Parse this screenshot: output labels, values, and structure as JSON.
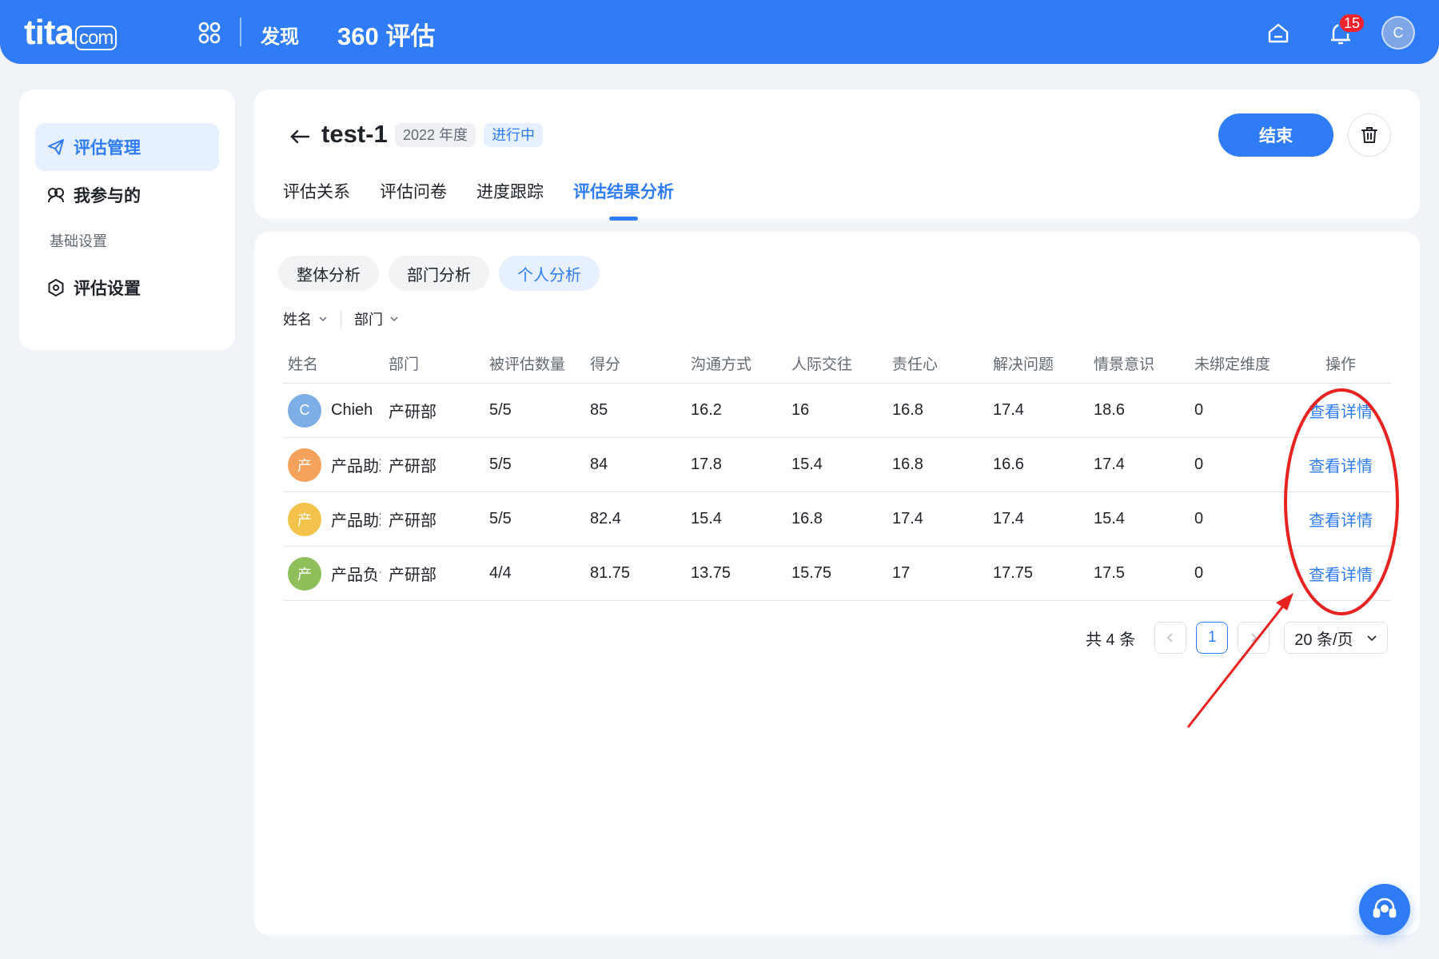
{
  "topbar": {
    "logo": "tita",
    "logo_suffix": "com",
    "nav_discover": "发现",
    "nav_title": "360 评估",
    "notification_count": "15",
    "user_initial": "C"
  },
  "sidebar": {
    "items": [
      {
        "label": "评估管理",
        "icon": "send-icon",
        "active": true
      },
      {
        "label": "我参与的",
        "icon": "people-icon",
        "active": false
      }
    ],
    "section_label": "基础设置",
    "settings_item": {
      "label": "评估设置",
      "icon": "gear-icon"
    }
  },
  "header": {
    "title": "test-1",
    "year_tag": "2022 年度",
    "status_tag": "进行中",
    "end_button": "结束",
    "tabs": [
      {
        "label": "评估关系",
        "active": false
      },
      {
        "label": "评估问卷",
        "active": false
      },
      {
        "label": "进度跟踪",
        "active": false
      },
      {
        "label": "评估结果分析",
        "active": true
      }
    ]
  },
  "analysis": {
    "segments": [
      {
        "label": "整体分析",
        "active": false
      },
      {
        "label": "部门分析",
        "active": false
      },
      {
        "label": "个人分析",
        "active": true
      }
    ],
    "filters": [
      "姓名",
      "部门"
    ]
  },
  "table": {
    "columns": [
      "姓名",
      "部门",
      "被评估数量",
      "得分",
      "沟通方式",
      "人际交往",
      "责任心",
      "解决问题",
      "情景意识",
      "未绑定维度",
      "操作"
    ],
    "rows": [
      {
        "avatar": "C",
        "avatar_color": "#7eaee6",
        "name": "Chieh",
        "dept": "产研部",
        "count": "5/5",
        "score": "85",
        "communication": "16.2",
        "interpersonal": "16",
        "responsibility": "16.8",
        "problem_solving": "17.4",
        "situational": "18.6",
        "unbound": "0",
        "action": "查看详情"
      },
      {
        "avatar": "产",
        "avatar_color": "#f5a25d",
        "name": "产品助理",
        "dept": "产研部",
        "count": "5/5",
        "score": "84",
        "communication": "17.8",
        "interpersonal": "15.4",
        "responsibility": "16.8",
        "problem_solving": "16.6",
        "situational": "17.4",
        "unbound": "0",
        "action": "查看详情"
      },
      {
        "avatar": "产",
        "avatar_color": "#f3c24b",
        "name": "产品助理",
        "dept": "产研部",
        "count": "5/5",
        "score": "82.4",
        "communication": "15.4",
        "interpersonal": "16.8",
        "responsibility": "17.4",
        "problem_solving": "17.4",
        "situational": "15.4",
        "unbound": "0",
        "action": "查看详情"
      },
      {
        "avatar": "产",
        "avatar_color": "#8fbf5a",
        "name": "产品负责人",
        "dept": "产研部",
        "count": "4/4",
        "score": "81.75",
        "communication": "13.75",
        "interpersonal": "15.75",
        "responsibility": "17",
        "problem_solving": "17.75",
        "situational": "17.5",
        "unbound": "0",
        "action": "查看详情"
      }
    ]
  },
  "pagination": {
    "total": "共 4 条",
    "current_page": "1",
    "page_size": "20 条/页"
  },
  "colors": {
    "primary": "#2f7cf6",
    "annotation": "#e8231f"
  }
}
